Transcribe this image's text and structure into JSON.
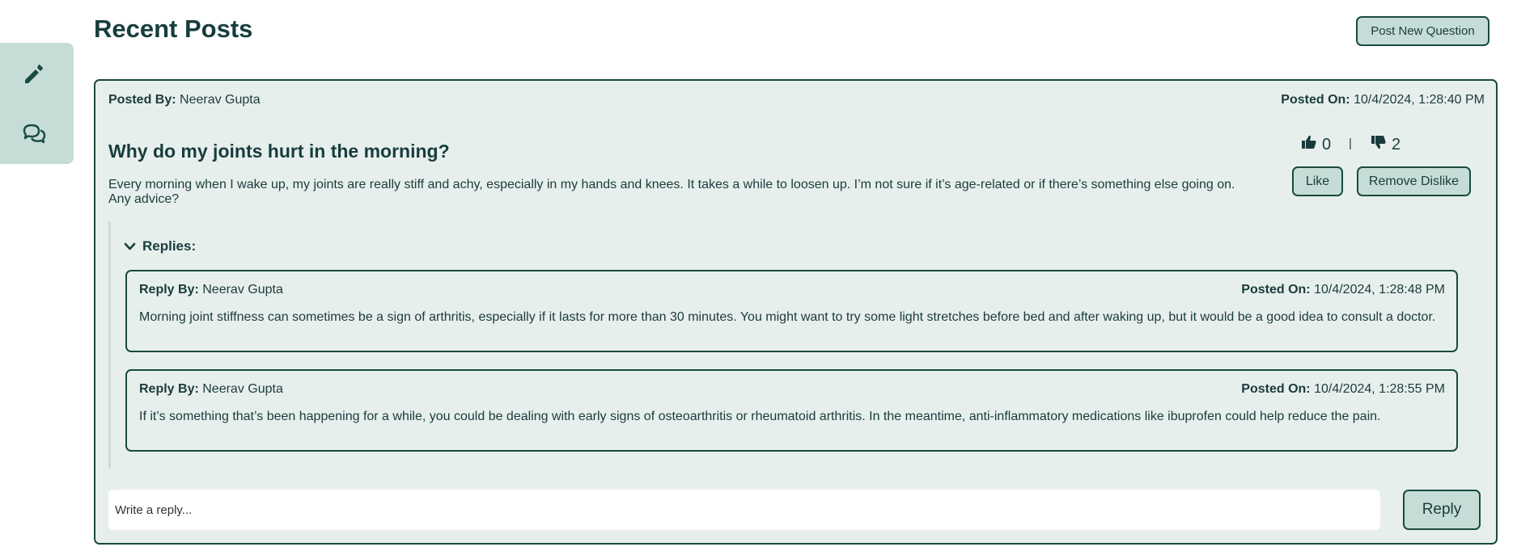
{
  "sidebar": {
    "icons": [
      "pencil-icon",
      "chat-bubbles-icon"
    ]
  },
  "header": {
    "title": "Recent Posts",
    "post_new_label": "Post New Question"
  },
  "post": {
    "posted_by_label": "Posted By:",
    "posted_by": "Neerav Gupta",
    "posted_on_label": "Posted On:",
    "posted_on": "10/4/2024, 1:28:40 PM",
    "title": "Why do my joints hurt in the morning?",
    "body": "Every morning when I wake up, my joints are really stiff and achy, especially in my hands and knees. It takes a while to loosen up. I’m not sure if it’s age-related or if there’s something else going on. Any advice?",
    "likes": "0",
    "dislikes": "2",
    "separator": "|",
    "like_label": "Like",
    "remove_dislike_label": "Remove Dislike"
  },
  "replies": {
    "label": "Replies:",
    "items": [
      {
        "by_label": "Reply By:",
        "by": "Neerav Gupta",
        "on_label": "Posted On:",
        "on": "10/4/2024, 1:28:48 PM",
        "text": "Morning joint stiffness can sometimes be a sign of arthritis, especially if it lasts for more than 30 minutes. You might want to try some light stretches before bed and after waking up, but it would be a good idea to consult a doctor."
      },
      {
        "by_label": "Reply By:",
        "by": "Neerav Gupta",
        "on_label": "Posted On:",
        "on": "10/4/2024, 1:28:55 PM",
        "text": "If it’s something that’s been happening for a while, you could be dealing with early signs of osteoarthritis or rheumatoid arthritis. In the meantime, anti-inflammatory medications like ibuprofen could help reduce the pain."
      }
    ]
  },
  "reply_form": {
    "placeholder": "Write a reply...",
    "value": "",
    "submit_label": "Reply"
  },
  "colors": {
    "accent": "#c6ddd7",
    "card_bg": "#e7efed",
    "border": "#1a4a40",
    "text": "#1a3b3b"
  }
}
